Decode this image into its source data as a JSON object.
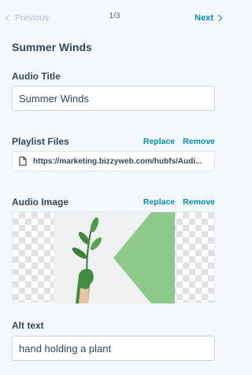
{
  "nav": {
    "previous_label": "Previous",
    "counter": "1/3",
    "next_label": "Next"
  },
  "heading": "Summer Winds",
  "audio_title": {
    "label": "Audio Title",
    "value": "Summer Winds"
  },
  "playlist_files": {
    "label": "Playlist Files",
    "replace_label": "Replace",
    "remove_label": "Remove",
    "file_url": "https://marketing.bizzyweb.com/hubfs/Audi..."
  },
  "audio_image": {
    "label": "Audio Image",
    "replace_label": "Replace",
    "remove_label": "Remove",
    "image_subject": "hand holding a plant"
  },
  "alt_text": {
    "label": "Alt text",
    "value": "hand holding a plant"
  },
  "colors": {
    "link": "#0091ae",
    "text": "#33475b",
    "background": "#f5f8fa",
    "image_accent_green": "#8dc98b"
  }
}
